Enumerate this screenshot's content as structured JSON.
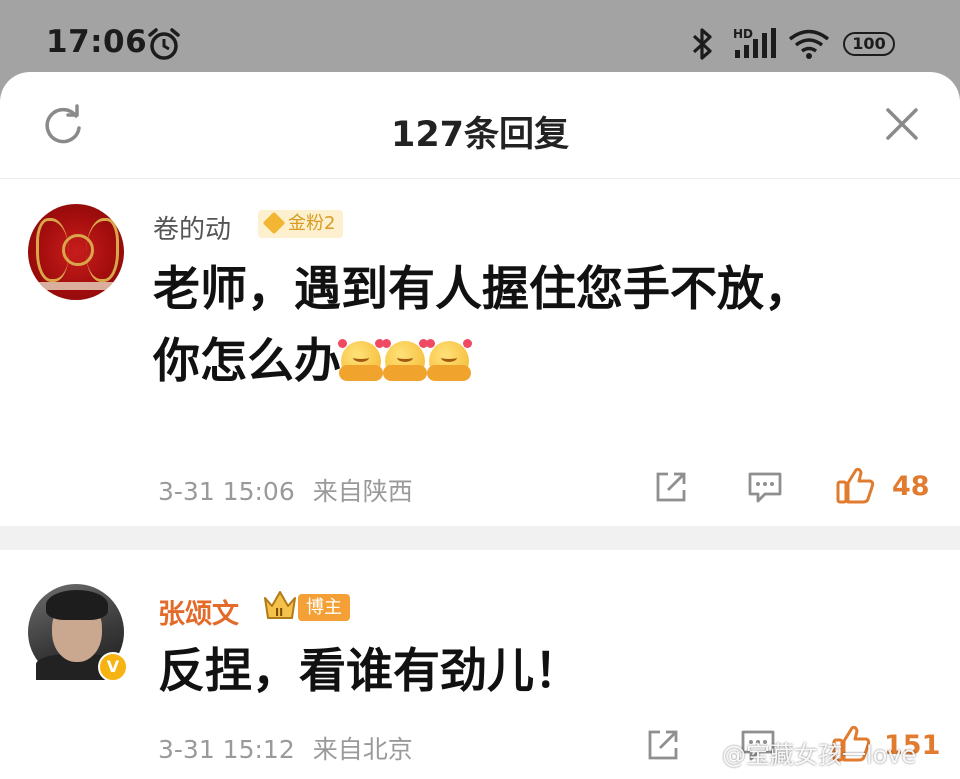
{
  "status_bar": {
    "time": "17:06",
    "battery": "100",
    "network_label": "HD"
  },
  "sheet": {
    "title": "127条回复"
  },
  "comments": [
    {
      "username": "卷的动",
      "badge": "金粉2",
      "text": "老师，遇到有人握住您手不放，你怎么办",
      "emoji_count": 3,
      "emoji_name": "hug-emoji",
      "timestamp": "3-31 15:06",
      "location": "来自陕西",
      "likes": "48"
    },
    {
      "username": "张颂文",
      "badge": "博主",
      "crown_label": "II",
      "text": "反捏，看谁有劲儿！",
      "timestamp": "3-31 15:12",
      "location": "来自北京",
      "likes": "151",
      "verified_mark": "V"
    }
  ],
  "watermark": "@宝藏女孩一love",
  "colors": {
    "accent": "#e07b2f",
    "username_host": "#e26b2a",
    "text": "#111111",
    "meta": "#9a9a9a"
  }
}
